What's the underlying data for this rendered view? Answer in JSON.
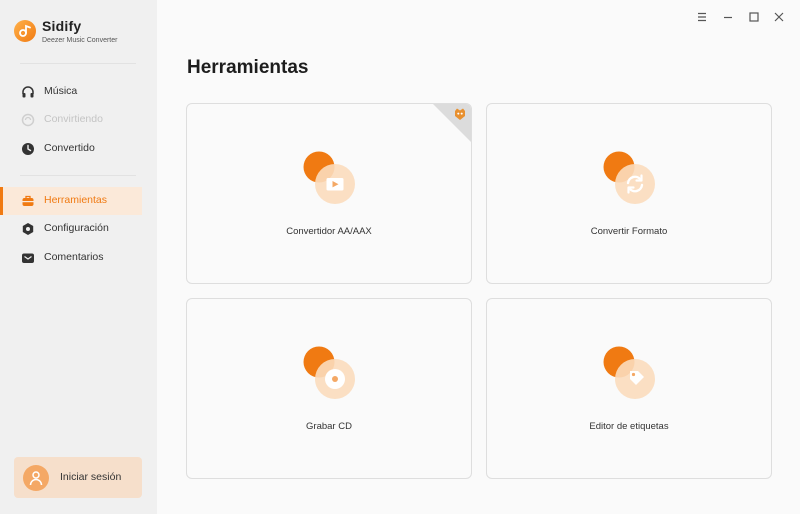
{
  "app": {
    "name": "Sidify",
    "subtitle": "Deezer Music Converter"
  },
  "sidebar": {
    "items": [
      {
        "label": "Música",
        "icon": "headphones-icon",
        "state": "normal"
      },
      {
        "label": "Convirtiendo",
        "icon": "converting-icon",
        "state": "disabled"
      },
      {
        "label": "Convertido",
        "icon": "clock-icon",
        "state": "normal"
      },
      {
        "label": "Herramientas",
        "icon": "toolbox-icon",
        "state": "active"
      },
      {
        "label": "Configuración",
        "icon": "gear-icon",
        "state": "normal"
      },
      {
        "label": "Comentarios",
        "icon": "mail-icon",
        "state": "normal"
      }
    ],
    "login_label": "Iniciar sesión"
  },
  "main": {
    "title": "Herramientas",
    "tools": [
      {
        "label": "Convertidor AA/AAX",
        "icon": "video-play-icon",
        "badge": "premium-badge-icon"
      },
      {
        "label": "Convertir Formato",
        "icon": "refresh-icon"
      },
      {
        "label": "Grabar CD",
        "icon": "cd-icon"
      },
      {
        "label": "Editor de etiquetas",
        "icon": "tag-icon"
      }
    ]
  },
  "window_controls": [
    "menu-icon",
    "minimize-icon",
    "maximize-icon",
    "close-icon"
  ],
  "colors": {
    "accent": "#f07a12",
    "accent_light": "#fbe9d9",
    "sidebar_bg": "#f0f0f0",
    "main_bg": "#fafafa"
  }
}
